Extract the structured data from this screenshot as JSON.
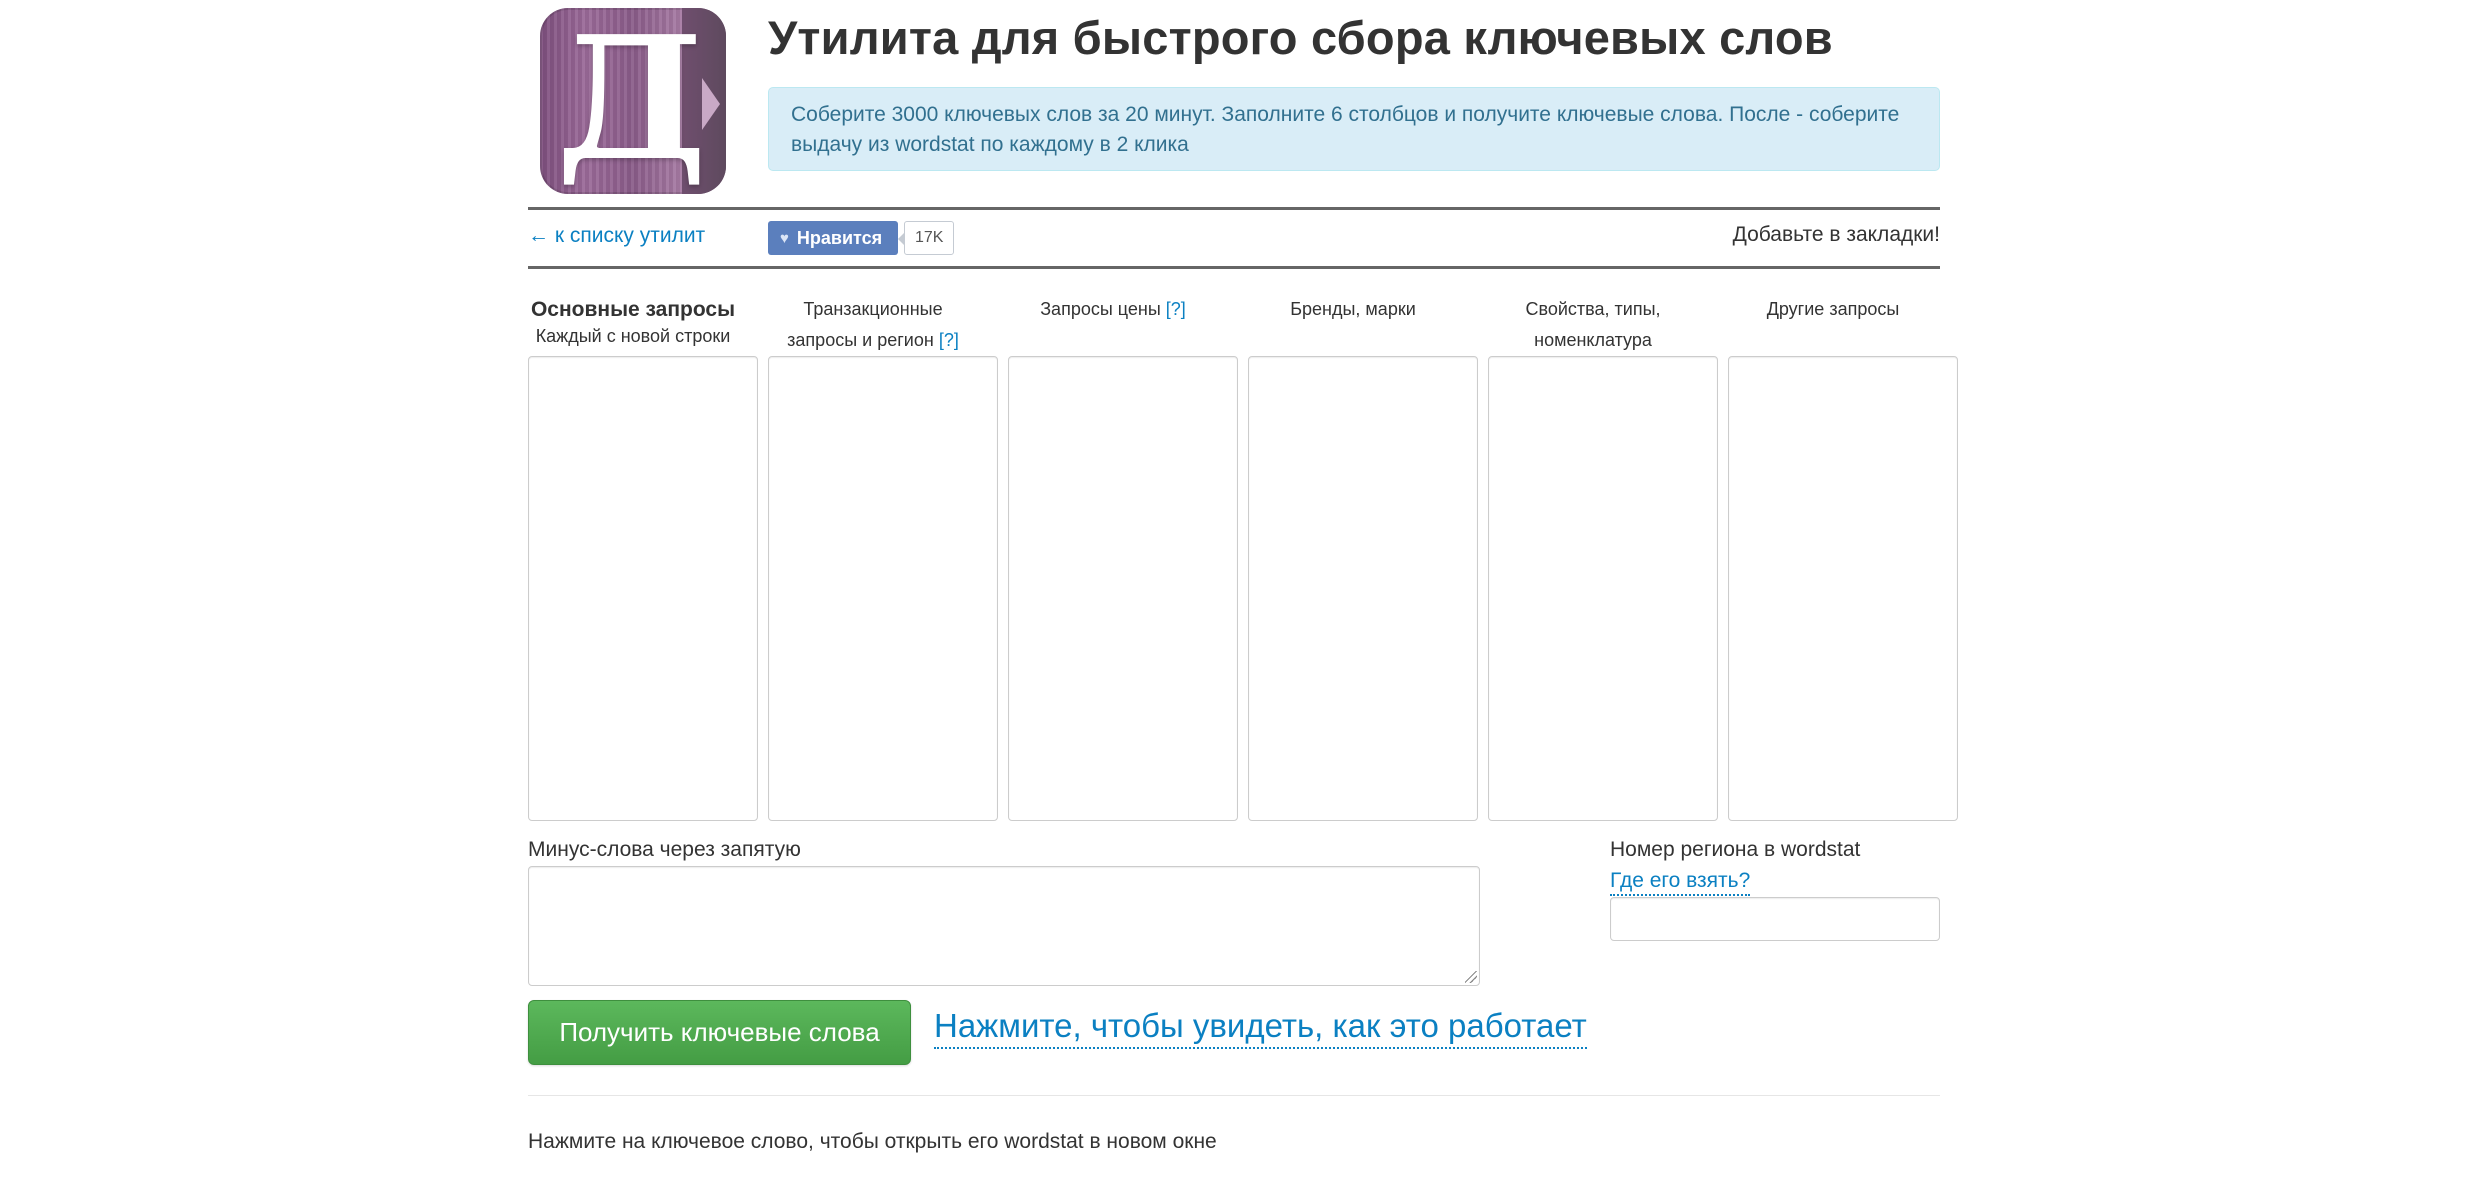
{
  "header": {
    "logo_icon": "letter-d-app-icon",
    "title": "Утилита для быстрого сбора ключевых слов",
    "info": "Соберите 3000 ключевых слов за 20 минут. Заполните 6 столбцов и получите ключевые слова. После - соберите выдачу из wordstat по каждому в 2 клика"
  },
  "toolbar": {
    "back_link": "← к списку утилит",
    "like_label": "Нравится",
    "like_count": "17K",
    "bookmark": "Добавьте в закладки!"
  },
  "columns": [
    {
      "title": "Основные запросы",
      "subtitle": "Каждый с новой строки",
      "hint": ""
    },
    {
      "title": "Транзакционные",
      "subtitle": "запросы и регион",
      "hint": "[?]"
    },
    {
      "title": "Запросы цены",
      "subtitle": "",
      "hint": "[?]"
    },
    {
      "title": "Бренды, марки",
      "subtitle": "",
      "hint": ""
    },
    {
      "title": "Свойства, типы,",
      "subtitle": "номенклатура",
      "hint": ""
    },
    {
      "title": "Другие запросы",
      "subtitle": "",
      "hint": ""
    }
  ],
  "form": {
    "minus_label": "Минус-слова через запятую",
    "region_label": "Номер региона в wordstat",
    "region_help_link": "Где его взять?",
    "submit_label": "Получить ключевые слова",
    "how_it_works_link": "Нажмите, чтобы увидеть, как это работает"
  },
  "footer": {
    "note": "Нажмите на ключевое слово, чтобы открыть его wordstat в новом окне"
  }
}
